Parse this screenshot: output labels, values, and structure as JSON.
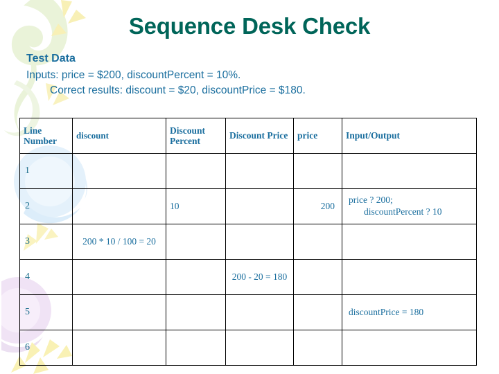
{
  "slide": {
    "title": "Sequence Desk Check",
    "subhead": "Test Data",
    "inputs_line": "Inputs: price = $200, discountPercent = 10%.",
    "results_line": "Correct results: discount = $20, discountPrice = $180.",
    "accent_title_color": "#006559",
    "accent_body_color": "#1a6e9e",
    "table_border_color": "#000000",
    "background_color": "#ffffff",
    "decor_green": "#e9f2d6",
    "decor_yellow": "#f7eeae",
    "decor_blue": "#e2f0fa",
    "decor_purple": "#efe1f3"
  },
  "table": {
    "headers": [
      "Line Number",
      "discount",
      "Discount Percent",
      "Discount Price",
      "price",
      "Input/Output"
    ],
    "rows": [
      {
        "line": "1",
        "discount": "",
        "discount_percent": "",
        "discount_price": "",
        "price": "",
        "io_line1": "",
        "io_line2": ""
      },
      {
        "line": "2",
        "discount": "",
        "discount_percent": "10",
        "discount_price": "",
        "price": "200",
        "io_line1": "price ? 200;",
        "io_line2": "discountPercent ? 10"
      },
      {
        "line": "3",
        "discount": "200 * 10 / 100 = 20",
        "discount_percent": "",
        "discount_price": "",
        "price": "",
        "io_line1": "",
        "io_line2": ""
      },
      {
        "line": "4",
        "discount": "",
        "discount_percent": "",
        "discount_price": "200 - 20 = 180",
        "price": "",
        "io_line1": "",
        "io_line2": ""
      },
      {
        "line": "5",
        "discount": "",
        "discount_percent": "",
        "discount_price": "",
        "price": "",
        "io_line1": "discountPrice = 180",
        "io_line2": ""
      },
      {
        "line": "6",
        "discount": "",
        "discount_percent": "",
        "discount_price": "",
        "price": "",
        "io_line1": "",
        "io_line2": ""
      }
    ]
  }
}
